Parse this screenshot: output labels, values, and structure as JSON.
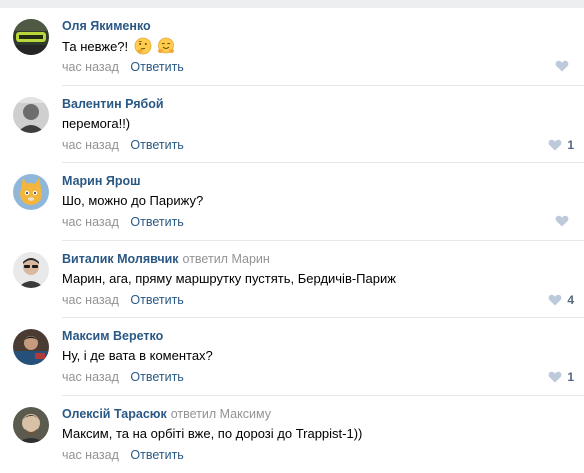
{
  "comments": [
    {
      "author": "Оля Якименко",
      "reply_to": "",
      "text": "Та невже?!",
      "emojis": [
        "thinking-face-emoji",
        "hugging-face-emoji"
      ],
      "time": "час назад",
      "reply_label": "Ответить",
      "likes": ""
    },
    {
      "author": "Валентин Рябой",
      "reply_to": "",
      "text": "перемога!!)",
      "emojis": [],
      "time": "час назад",
      "reply_label": "Ответить",
      "likes": "1"
    },
    {
      "author": "Марин Ярош",
      "reply_to": "",
      "text": "Шо, можно до Парижу?",
      "emojis": [],
      "time": "час назад",
      "reply_label": "Ответить",
      "likes": ""
    },
    {
      "author": "Виталик Молявчик",
      "reply_to": "ответил Марин",
      "text": "Марин, ага, пряму маршрутку пустять, Бердичів-Париж",
      "emojis": [],
      "time": "час назад",
      "reply_label": "Ответить",
      "likes": "4"
    },
    {
      "author": "Максим Веретко",
      "reply_to": "",
      "text": "Ну, і де вата в коментах?",
      "emojis": [],
      "time": "час назад",
      "reply_label": "Ответить",
      "likes": "1"
    },
    {
      "author": "Олексій Тарасюк",
      "reply_to": "ответил Максиму",
      "text": "Максим, та на орбіті вже, по дорозі до Trappist-1))",
      "emojis": [],
      "time": "час назад",
      "reply_label": "Ответить",
      "likes": ""
    }
  ],
  "colors": {
    "author_link": "#2a5885",
    "secondary_text": "#939393",
    "like_heart": "#bccadb",
    "like_count": "#55677d",
    "divider": "#e7e8ec"
  },
  "icons": {
    "like": "heart-icon",
    "emoji_1": "thinking-face-emoji",
    "emoji_2": "hugging-face-emoji"
  }
}
